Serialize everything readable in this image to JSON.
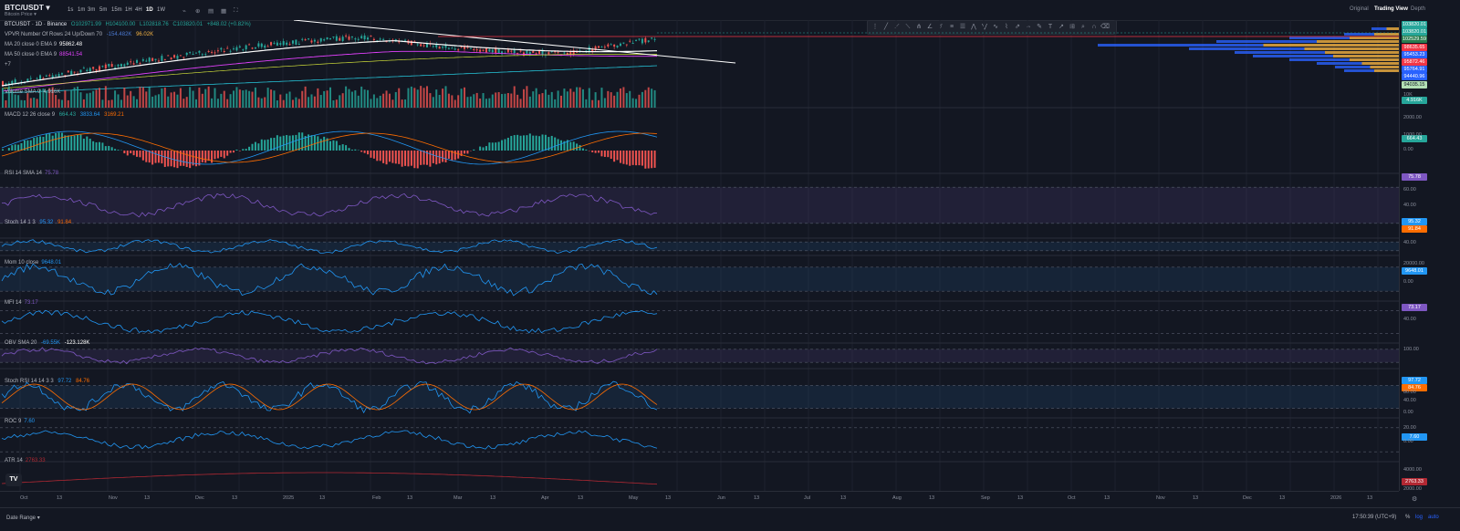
{
  "header": {
    "symbol": "BTC/USDT",
    "subtitle": "Bitcoin Price ▾",
    "timeframes": [
      "1s",
      "1m",
      "3m",
      "5m",
      "15m",
      "1H",
      "4H",
      "1D",
      "1W"
    ],
    "active_timeframe": "1D",
    "views": [
      "Original",
      "Trading View",
      "Depth"
    ],
    "active_view": "Trading View"
  },
  "legend": {
    "main": {
      "label": "BTCUSDT · 1D · Binance",
      "o": "O102971.99",
      "h": "H104100.00",
      "l": "L102818.76",
      "c": "C103820.01",
      "chg": "+848.02 (+0.82%)"
    },
    "vpvr": {
      "label": "VPVR Number Of Rows 24 Up/Down 70",
      "v1": "-154.482K",
      "v2": "96.02K"
    },
    "ma20": {
      "label": "MA 20 close 0 EMA 9",
      "value": "95862.48"
    },
    "ma50": {
      "label": "MA 50 close 0 EMA 9",
      "value": "88541.54"
    },
    "more": "+7",
    "volume": {
      "label": "Volume SMA 9",
      "value": "4.916K"
    },
    "macd": {
      "label": "MACD 12 26 close 9",
      "v1": "664.43",
      "v2": "3833.64",
      "v3": "3169.21"
    },
    "rsi": {
      "label": "RSI 14 SMA 14",
      "value": "75.78"
    },
    "stoch": {
      "label": "Stoch 14 1 3",
      "v1": "95.32",
      "v2": "91.84"
    },
    "mom": {
      "label": "Mom 10 close",
      "value": "9648.01"
    },
    "mfi": {
      "label": "MFI 14",
      "value": "73.17"
    },
    "obv": {
      "label": "OBV SMA 20",
      "v1": "-69.55K",
      "v2": "-123.128K"
    },
    "stochrsi": {
      "label": "Stoch RSI 14 14 3 3",
      "v1": "97.72",
      "v2": "84.76"
    },
    "roc": {
      "label": "ROC 9",
      "value": "7.60"
    },
    "atr": {
      "label": "ATR 14",
      "value": "2763.33"
    }
  },
  "price_badges": [
    {
      "text": "103820.01",
      "color": "#26a69a"
    },
    {
      "text": "103820.01",
      "color": "#26a69a"
    },
    {
      "text": "102529.59",
      "color": "#2a7d4f"
    },
    {
      "text": "98635.65",
      "color": "#f23645"
    },
    {
      "text": "95453.23",
      "color": "#2962ff"
    },
    {
      "text": "95872.46",
      "color": "#f23645"
    },
    {
      "text": "95764.91",
      "color": "#2962ff"
    },
    {
      "text": "94440.96",
      "color": "#2962ff"
    },
    {
      "text": "94035.15",
      "color": "#b2e0b5"
    }
  ],
  "indicator_badges": {
    "volume": {
      "text": "4.916K",
      "color": "#26a69a"
    },
    "macd": {
      "text": "664.43",
      "color": "#26a69a"
    },
    "rsi": {
      "text": "75.78",
      "color": "#7e57c2"
    },
    "stoch1": {
      "text": "95.32",
      "color": "#2196f3"
    },
    "stoch2": {
      "text": "91.84",
      "color": "#ff6d00"
    },
    "mom": {
      "text": "9648.01",
      "color": "#2196f3"
    },
    "mfi": {
      "text": "73.17",
      "color": "#7e57c2"
    },
    "stochrsi1": {
      "text": "97.72",
      "color": "#2196f3"
    },
    "stochrsi2": {
      "text": "84.76",
      "color": "#ff6d00"
    },
    "roc": {
      "text": "7.60",
      "color": "#2196f3"
    },
    "atr": {
      "text": "2763.33",
      "color": "#b22833"
    }
  },
  "axis_ticks": {
    "volume": [
      "10K"
    ],
    "macd": [
      "2000.00",
      "1000.00",
      "0.00"
    ],
    "rsi": [
      "60.00",
      "40.00"
    ],
    "stoch": [
      "40.00"
    ],
    "mom": [
      "20000.00",
      "0.00"
    ],
    "mfi": [
      "40.00"
    ],
    "obv": [
      "100.00"
    ],
    "stochrsi": [
      "80.00",
      "40.00",
      "0.00"
    ],
    "roc": [
      "20.00",
      "0.00"
    ],
    "atr": [
      "4000.00",
      "2000.00"
    ]
  },
  "time_labels": [
    "Oct",
    "13",
    "Nov",
    "13",
    "Dec",
    "13",
    "2025",
    "13",
    "Feb",
    "13",
    "Mar",
    "13",
    "Apr",
    "13",
    "May",
    "13",
    "Jun",
    "13",
    "Jul",
    "13",
    "Aug",
    "13",
    "Sep",
    "13",
    "Oct",
    "13",
    "Nov",
    "13",
    "Dec",
    "13",
    "2026",
    "13"
  ],
  "footer": {
    "date_range": "Date Range ▾",
    "clock": "17:50:39 (UTC+9)",
    "pct": "%",
    "log": "log",
    "auto": "auto"
  },
  "icons": {
    "settings": "gear-icon",
    "tv_logo": "tradingview-logo-icon"
  },
  "colors": {
    "bg": "#131722",
    "up": "#26a69a",
    "down": "#ef5350",
    "grid": "#2a2e39"
  }
}
